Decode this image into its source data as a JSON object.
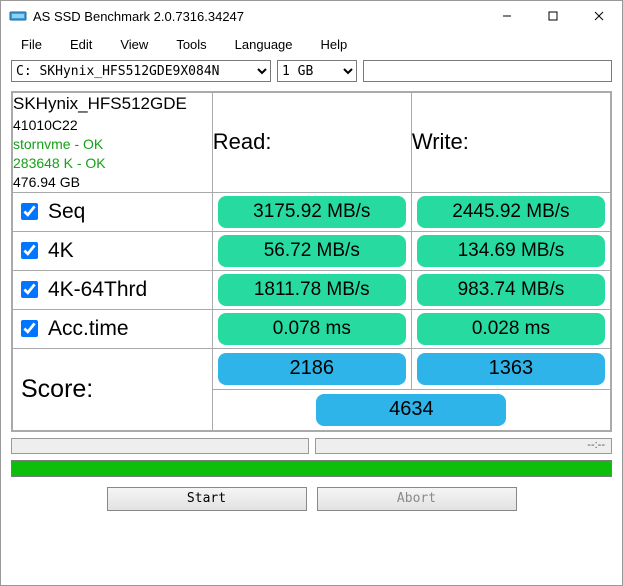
{
  "window": {
    "title": "AS SSD Benchmark 2.0.7316.34247"
  },
  "menu": {
    "file": "File",
    "edit": "Edit",
    "view": "View",
    "tools": "Tools",
    "language": "Language",
    "help": "Help"
  },
  "toolbar": {
    "drive": "C: SKHynix_HFS512GDE9X084N",
    "size": "1 GB"
  },
  "info": {
    "model": "SKHynix_HFS512GDE",
    "fw": "41010C22",
    "driver": "stornvme - OK",
    "align": "283648 K - OK",
    "capacity": "476.94 GB"
  },
  "headers": {
    "read": "Read:",
    "write": "Write:"
  },
  "rows": {
    "seq": {
      "label": "Seq",
      "read": "3175.92 MB/s",
      "write": "2445.92 MB/s"
    },
    "k4": {
      "label": "4K",
      "read": "56.72 MB/s",
      "write": "134.69 MB/s"
    },
    "k4t": {
      "label": "4K-64Thrd",
      "read": "1811.78 MB/s",
      "write": "983.74 MB/s"
    },
    "acc": {
      "label": "Acc.time",
      "read": "0.078 ms",
      "write": "0.028 ms"
    }
  },
  "score": {
    "label": "Score:",
    "read": "2186",
    "write": "1363",
    "total": "4634"
  },
  "status_right": "--:--",
  "buttons": {
    "start": "Start",
    "abort": "Abort"
  },
  "chart_data": {
    "type": "table",
    "title": "AS SSD Benchmark results",
    "drive": "SKHynix_HFS512GDE9X084N",
    "capacity_gb": 476.94,
    "test_size": "1 GB",
    "metrics": [
      {
        "test": "Seq",
        "read_mb_s": 3175.92,
        "write_mb_s": 2445.92
      },
      {
        "test": "4K",
        "read_mb_s": 56.72,
        "write_mb_s": 134.69
      },
      {
        "test": "4K-64Thrd",
        "read_mb_s": 1811.78,
        "write_mb_s": 983.74
      },
      {
        "test": "Acc.time",
        "read_ms": 0.078,
        "write_ms": 0.028
      }
    ],
    "score": {
      "read": 2186,
      "write": 1363,
      "total": 4634
    }
  }
}
